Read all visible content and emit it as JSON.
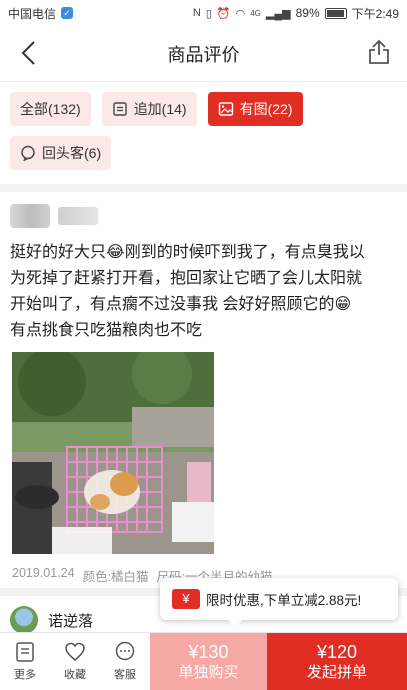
{
  "status_bar": {
    "carrier": "中国电信",
    "battery": "89%",
    "time": "下午2:49",
    "network": "4G"
  },
  "nav": {
    "title": "商品评价"
  },
  "filters": [
    {
      "label": "全部(132)",
      "icon": "none",
      "active": false
    },
    {
      "label": "追加(14)",
      "icon": "document-icon",
      "active": false
    },
    {
      "label": "有图(22)",
      "icon": "image-icon",
      "active": true
    },
    {
      "label": "回头客(6)",
      "icon": "chat-icon",
      "active": false
    }
  ],
  "review": {
    "text_lines": [
      "挺好的好大只😂刚到的时候吓到我了，有点臭我以",
      "为死掉了赶紧打开看，抱回家让它晒了会儿太阳就",
      "开始叫了，有点瘸不过没事我 会好好照顾它的😁",
      "有点挑食只吃猫粮肉也不吃"
    ],
    "date": "2019.01.24",
    "color": "颜色:橘白猫",
    "size": "尺码:一个半月的幼猫"
  },
  "reviewer2": {
    "name": "诺逆落"
  },
  "promo": {
    "badge": "¥",
    "text": "限时优惠,下单立减2.88元!"
  },
  "bottom_bar": {
    "more": "更多",
    "favorite": "收藏",
    "service": "客服",
    "single_price": "¥130",
    "single_label": "单独购买",
    "group_price": "¥120",
    "group_label": "发起拼单"
  },
  "colors": {
    "accent": "#e02e24",
    "accent_light": "#f6a9a4",
    "tag_bg": "#fbe9e8"
  }
}
